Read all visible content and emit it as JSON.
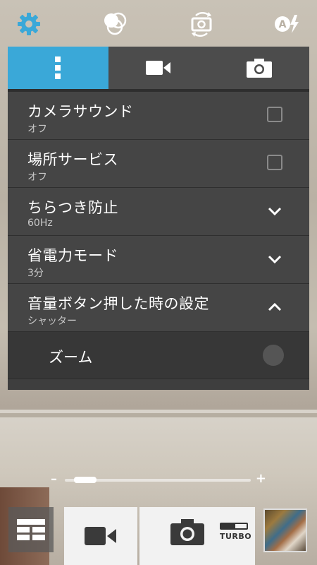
{
  "topbar": {
    "icons": [
      "gear-icon",
      "color-effect-icon",
      "switch-camera-icon",
      "auto-flash-icon"
    ],
    "accent": "#3aa8d8"
  },
  "panel": {
    "tabs": [
      {
        "icon": "more-vertical-icon",
        "active": true
      },
      {
        "icon": "video-camera-icon",
        "active": false
      },
      {
        "icon": "camera-icon",
        "active": false
      }
    ],
    "rows": [
      {
        "title": "カメラサウンド",
        "value": "オフ",
        "control": "checkbox"
      },
      {
        "title": "場所サービス",
        "value": "オフ",
        "control": "checkbox"
      },
      {
        "title": "ちらつき防止",
        "value": "60Hz",
        "control": "chevron-down"
      },
      {
        "title": "省電力モード",
        "value": "3分",
        "control": "chevron-down"
      },
      {
        "title": "音量ボタン押した時の設定",
        "value": "シャッター",
        "control": "chevron-up"
      }
    ],
    "sub_options": [
      {
        "label": "ズーム",
        "selected": false
      }
    ]
  },
  "zoom": {
    "minus": "–",
    "plus": "+",
    "level": 0.05
  },
  "bottom": {
    "turbo_label": "TURBO",
    "turbo_level": 0.55
  }
}
